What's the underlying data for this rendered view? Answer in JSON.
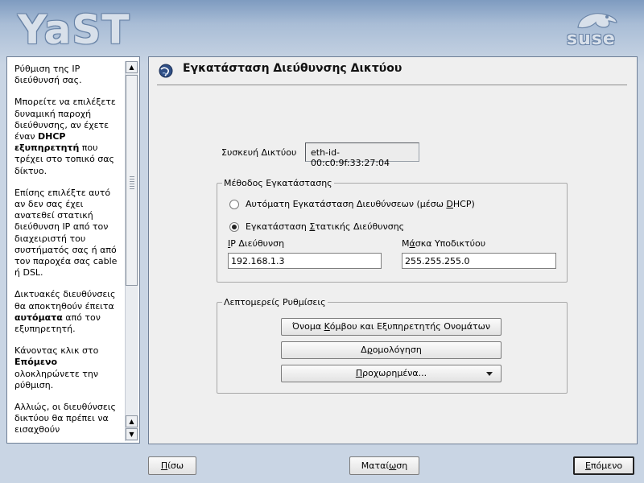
{
  "header": {
    "app_logo": "YaST",
    "brand_logo": "suse"
  },
  "help": {
    "paragraphs": [
      [
        {
          "t": "Ρύθμιση της IP διεύθυνσή σας."
        }
      ],
      [
        {
          "t": "Μπορείτε να επιλέξετε δυναμική παροχή διεύθυνσης, αν έχετε έναν "
        },
        {
          "t": "DHCP εξυπηρετητή",
          "b": true
        },
        {
          "t": " που τρέχει στο τοπικό σας δίκτυο."
        }
      ],
      [
        {
          "t": "Επίσης επιλέξτε αυτό αν δεν σας έχει ανατεθεί στατική διεύθυνση IP από τον διαχειριστή του συστήματός σας ή από τον παροχέα σας cable ή DSL."
        }
      ],
      [
        {
          "t": "Δικτυακές διευθύνσεις θα αποκτηθούν έπειτα "
        },
        {
          "t": "αυτόματα",
          "b": true
        },
        {
          "t": " από τον εξυπηρετητή."
        }
      ],
      [
        {
          "t": "Κάνοντας κλικ στο "
        },
        {
          "t": "Επόμενο",
          "b": true
        },
        {
          "t": " ολοκληρώνετε την ρύθμιση."
        }
      ],
      [
        {
          "t": "Αλλιώς, οι διευθύνσεις δικτύου θα πρέπει να εισαχθούν"
        }
      ]
    ]
  },
  "main": {
    "title": "Εγκατάσταση Διεύθυνσης Δικτύου",
    "device_label": "Συσκευή Δικτύου",
    "device_value": "eth-id-00:c0:9f:33:27:04",
    "setup_method": {
      "legend": "Μέθοδος Εγκατάστασης",
      "option_dhcp": {
        "pre": "Αυτόματη Εγκατάσταση Διευθύνσεων (μέσω ",
        "key": "D",
        "post": "HCP)",
        "selected": false
      },
      "option_static": {
        "pre": "Εγκατάσταση ",
        "key": "Σ",
        "post": "τατικής Διεύθυνσης",
        "selected": true
      },
      "ip_label": {
        "pre": "",
        "key": "I",
        "post": "P Διεύθυνση"
      },
      "ip_value": "192.168.1.3",
      "mask_label": {
        "pre": "Μ",
        "key": "ά",
        "post": "σκα Υποδικτύου"
      },
      "mask_value": "255.255.255.0"
    },
    "detailed": {
      "legend": "Λεπτομερείς Ρυθμίσεις",
      "hostname_button": {
        "pre": "Όνομα ",
        "key": "Κ",
        "post": "όμβου και Εξυπηρετητής Ονομάτων"
      },
      "routing_button": {
        "pre": "Δ",
        "key": "ρ",
        "post": "ομολόγηση"
      },
      "advanced_button": {
        "pre": "",
        "key": "Π",
        "post": "ροχωρημένα..."
      }
    }
  },
  "footer": {
    "back": {
      "pre": "",
      "key": "Π",
      "post": "ίσω"
    },
    "abort": {
      "pre": "Ματαί",
      "key": "ω",
      "post": "ση"
    },
    "next": {
      "pre": "",
      "key": "Ε",
      "post": "πόμενο"
    }
  }
}
